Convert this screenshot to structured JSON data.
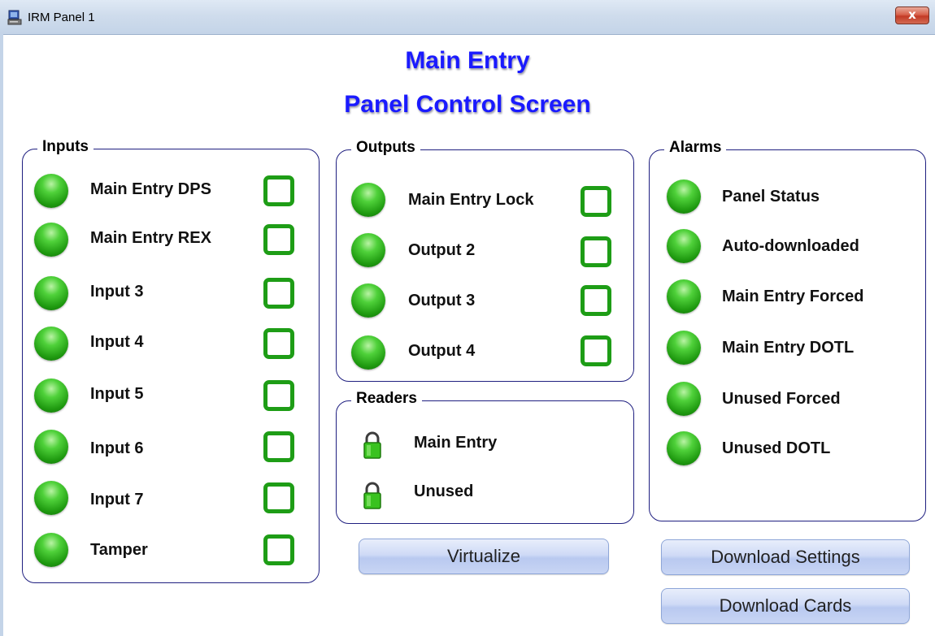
{
  "window": {
    "title": "IRM Panel 1",
    "close_label": "x"
  },
  "header": {
    "line1": "Main Entry",
    "line2": "Panel Control Screen"
  },
  "inputs": {
    "title": "Inputs",
    "items": [
      {
        "label": "Main Entry DPS"
      },
      {
        "label": "Main Entry REX"
      },
      {
        "label": "Input 3"
      },
      {
        "label": "Input 4"
      },
      {
        "label": "Input 5"
      },
      {
        "label": "Input 6"
      },
      {
        "label": "Input 7"
      },
      {
        "label": "Tamper"
      }
    ]
  },
  "outputs": {
    "title": "Outputs",
    "items": [
      {
        "label": "Main Entry Lock"
      },
      {
        "label": "Output 2"
      },
      {
        "label": "Output 3"
      },
      {
        "label": "Output 4"
      }
    ]
  },
  "readers": {
    "title": "Readers",
    "items": [
      {
        "label": "Main Entry"
      },
      {
        "label": "Unused"
      }
    ]
  },
  "alarms": {
    "title": "Alarms",
    "items": [
      {
        "label": "Panel Status"
      },
      {
        "label": "Auto-downloaded"
      },
      {
        "label": "Main Entry Forced"
      },
      {
        "label": "Main Entry DOTL"
      },
      {
        "label": "Unused Forced"
      },
      {
        "label": "Unused DOTL"
      }
    ]
  },
  "buttons": {
    "virtualize": "Virtualize",
    "download_settings": "Download Settings",
    "download_cards": "Download Cards"
  },
  "colors": {
    "heading": "#1a1aff",
    "led": "#2fb21a",
    "checkbox_border": "#1e9d16",
    "group_border": "#1f1f80"
  },
  "icons": {
    "status": "green-led-icon",
    "reader": "green-padlock-icon"
  }
}
